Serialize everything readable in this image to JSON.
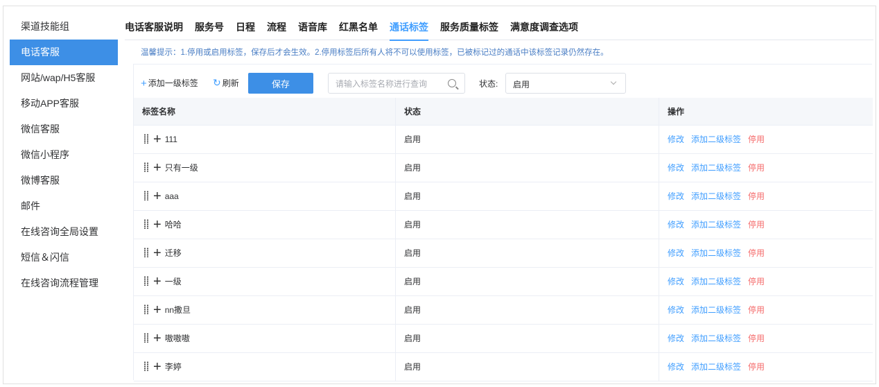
{
  "sidebar": {
    "items": [
      {
        "label": "渠道技能组",
        "active": false
      },
      {
        "label": "电话客服",
        "active": true
      },
      {
        "label": "网站/wap/H5客服",
        "active": false
      },
      {
        "label": "移动APP客服",
        "active": false
      },
      {
        "label": "微信客服",
        "active": false
      },
      {
        "label": "微信小程序",
        "active": false
      },
      {
        "label": "微博客服",
        "active": false
      },
      {
        "label": "邮件",
        "active": false
      },
      {
        "label": "在线咨询全局设置",
        "active": false
      },
      {
        "label": "短信＆闪信",
        "active": false
      },
      {
        "label": "在线咨询流程管理",
        "active": false
      }
    ]
  },
  "tabs": [
    {
      "label": "电话客服说明",
      "active": false
    },
    {
      "label": "服务号",
      "active": false
    },
    {
      "label": "日程",
      "active": false
    },
    {
      "label": "流程",
      "active": false
    },
    {
      "label": "语音库",
      "active": false
    },
    {
      "label": "红黑名单",
      "active": false
    },
    {
      "label": "通话标签",
      "active": true
    },
    {
      "label": "服务质量标签",
      "active": false
    },
    {
      "label": "满意度调查选项",
      "active": false
    }
  ],
  "tip": "温馨提示：1.停用或启用标签，保存后才会生效。2.停用标签后所有人将不可以使用标签，已被标记过的通话中该标签记录仍然存在。",
  "toolbar": {
    "add_label": "添加一级标签",
    "refresh_label": "刷新",
    "save_label": "保存",
    "search_placeholder": "请输入标签名称进行查询",
    "status_label": "状态:",
    "status_value": "启用"
  },
  "table": {
    "headers": [
      "标签名称",
      "状态",
      "操作"
    ],
    "rows": [
      {
        "name": "111",
        "status": "启用"
      },
      {
        "name": "只有一级",
        "status": "启用"
      },
      {
        "name": "aaa",
        "status": "启用"
      },
      {
        "name": "哈哈",
        "status": "启用"
      },
      {
        "name": "迁移",
        "status": "启用"
      },
      {
        "name": "一级",
        "status": "启用"
      },
      {
        "name": "nn撒旦",
        "status": "启用"
      },
      {
        "name": "嗷嗷嗷",
        "status": "启用"
      },
      {
        "name": "李婷",
        "status": "启用"
      }
    ],
    "actions": {
      "edit": "修改",
      "add_child": "添加二级标签",
      "disable": "停用"
    }
  },
  "colors": {
    "accent": "#409eff",
    "sidebar_active": "#3d8fe6",
    "danger": "#f56c6c"
  }
}
